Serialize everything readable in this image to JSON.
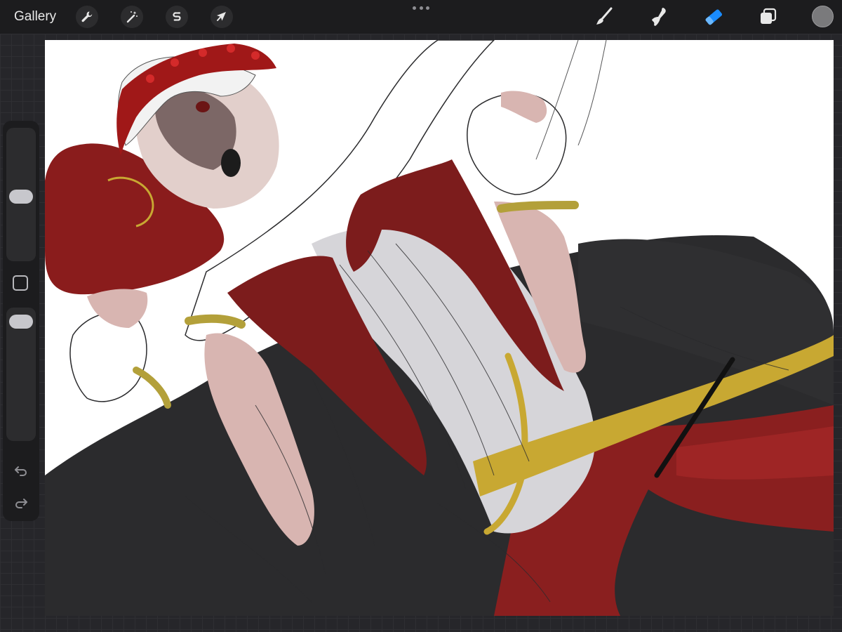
{
  "app": {
    "gallery_label": "Gallery"
  },
  "toolbar": {
    "left_tools": [
      {
        "name": "actions",
        "icon": "wrench-icon"
      },
      {
        "name": "adjustments",
        "icon": "magic-wand-icon"
      },
      {
        "name": "selection",
        "icon": "selection-s-icon"
      },
      {
        "name": "transform",
        "icon": "arrow-cursor-icon"
      }
    ],
    "right_tools": [
      {
        "name": "brush",
        "icon": "brush-icon",
        "active": false
      },
      {
        "name": "smudge",
        "icon": "smudge-icon",
        "active": false
      },
      {
        "name": "eraser",
        "icon": "eraser-icon",
        "active": true
      },
      {
        "name": "layers",
        "icon": "layers-icon",
        "active": false
      }
    ],
    "active_color": "#7a7a7c",
    "accent_color": "#1a8cff"
  },
  "sidebar": {
    "brush_size_level": 0.55,
    "opacity_level": 0.85,
    "icons": [
      "square-modify-icon",
      "undo-icon",
      "redo-icon"
    ]
  },
  "canvas": {
    "colors": {
      "background": "#ffffff",
      "red": "#7c1c1c",
      "gold": "#c8a832",
      "skin": "#d8b5b1",
      "dark": "#2b2b2d",
      "shirt": "#d6d5d9"
    }
  }
}
